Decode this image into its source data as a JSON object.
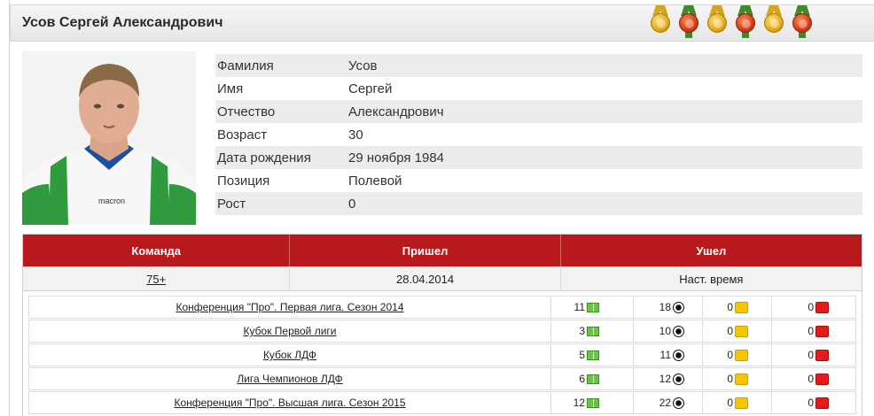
{
  "player": {
    "full_name": "Усов Сергей Александрович"
  },
  "medals": [
    {
      "icon": "gold-medal-icon",
      "kind": "gold"
    },
    {
      "icon": "bronze-medal-icon",
      "kind": "red"
    },
    {
      "icon": "gold-medal-icon",
      "kind": "gold"
    },
    {
      "icon": "bronze-medal-icon",
      "kind": "red"
    },
    {
      "icon": "gold-medal-icon",
      "kind": "gold"
    },
    {
      "icon": "bronze-medal-icon",
      "kind": "red"
    }
  ],
  "info": [
    {
      "label": "Фамилия",
      "value": "Усов"
    },
    {
      "label": "Имя",
      "value": "Сергей"
    },
    {
      "label": "Отчество",
      "value": "Александрович"
    },
    {
      "label": "Возраст",
      "value": "30"
    },
    {
      "label": "Дата рождения",
      "value": "29 ноября 1984"
    },
    {
      "label": "Позиция",
      "value": "Полевой"
    },
    {
      "label": "Рост",
      "value": "0"
    }
  ],
  "teams": {
    "headers": {
      "team": "Команда",
      "joined": "Пришел",
      "left": "Ушел"
    },
    "rows": [
      {
        "team": "75+",
        "joined": "28.04.2014",
        "left": "Наст. время"
      }
    ]
  },
  "stats": [
    {
      "tournament": "Конференция \"Про\". Первая лига. Сезон 2014",
      "games": "11",
      "goals": "18",
      "yellow": "0",
      "red": "0"
    },
    {
      "tournament": "Кубок Первой лиги",
      "games": "3",
      "goals": "10",
      "yellow": "0",
      "red": "0"
    },
    {
      "tournament": "Кубок ЛДФ",
      "games": "5",
      "goals": "11",
      "yellow": "0",
      "red": "0"
    },
    {
      "tournament": "Лига Чемпионов ЛДФ",
      "games": "6",
      "goals": "12",
      "yellow": "0",
      "red": "0"
    },
    {
      "tournament": "Конференция \"Про\". Высшая лига. Сезон 2015",
      "games": "12",
      "goals": "22",
      "yellow": "0",
      "red": "0"
    }
  ],
  "colors": {
    "accent": "#b8191c",
    "header_bg": "#e9e9e9",
    "row_alt": "#ececec"
  }
}
